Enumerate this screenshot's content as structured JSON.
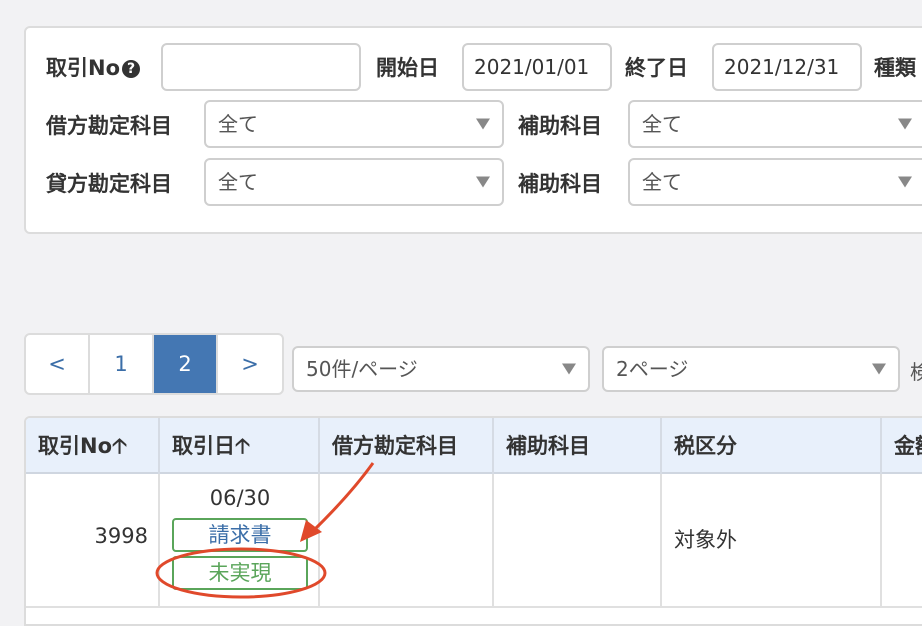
{
  "filters": {
    "txn_no_label": "取引No",
    "txn_no_value": "",
    "start_label": "開始日",
    "start_value": "2021/01/01",
    "end_label": "終了日",
    "end_value": "2021/12/31",
    "type_label": "種類",
    "debit_label": "借方勘定科目",
    "debit_value": "全て",
    "debit_sub_label": "補助科目",
    "debit_sub_value": "全て",
    "credit_label": "貸方勘定科目",
    "credit_value": "全て",
    "credit_sub_label": "補助科目",
    "credit_sub_value": "全て"
  },
  "pagination": {
    "prev": "<",
    "pages": [
      "1",
      "2"
    ],
    "current": "2",
    "next": ">",
    "per_page": "50件/ページ",
    "page_select": "2ページ",
    "trailing": "検"
  },
  "table": {
    "columns": [
      "取引No",
      "取引日",
      "借方勘定科目",
      "補助科目",
      "税区分",
      "金額"
    ],
    "rows": [
      {
        "txn_no": "3998",
        "date": "06/30",
        "badge_invoice": "請求書",
        "badge_status": "未実現",
        "debit_account": "",
        "sub_account": "",
        "tax_category": "対象外"
      }
    ]
  },
  "annotation": {
    "color": "#e0492b"
  },
  "colors": {
    "accent": "#4477b3",
    "header_bg": "#e8f0fb",
    "badge_green": "#5aa55a",
    "link_blue": "#3b6ea8"
  }
}
